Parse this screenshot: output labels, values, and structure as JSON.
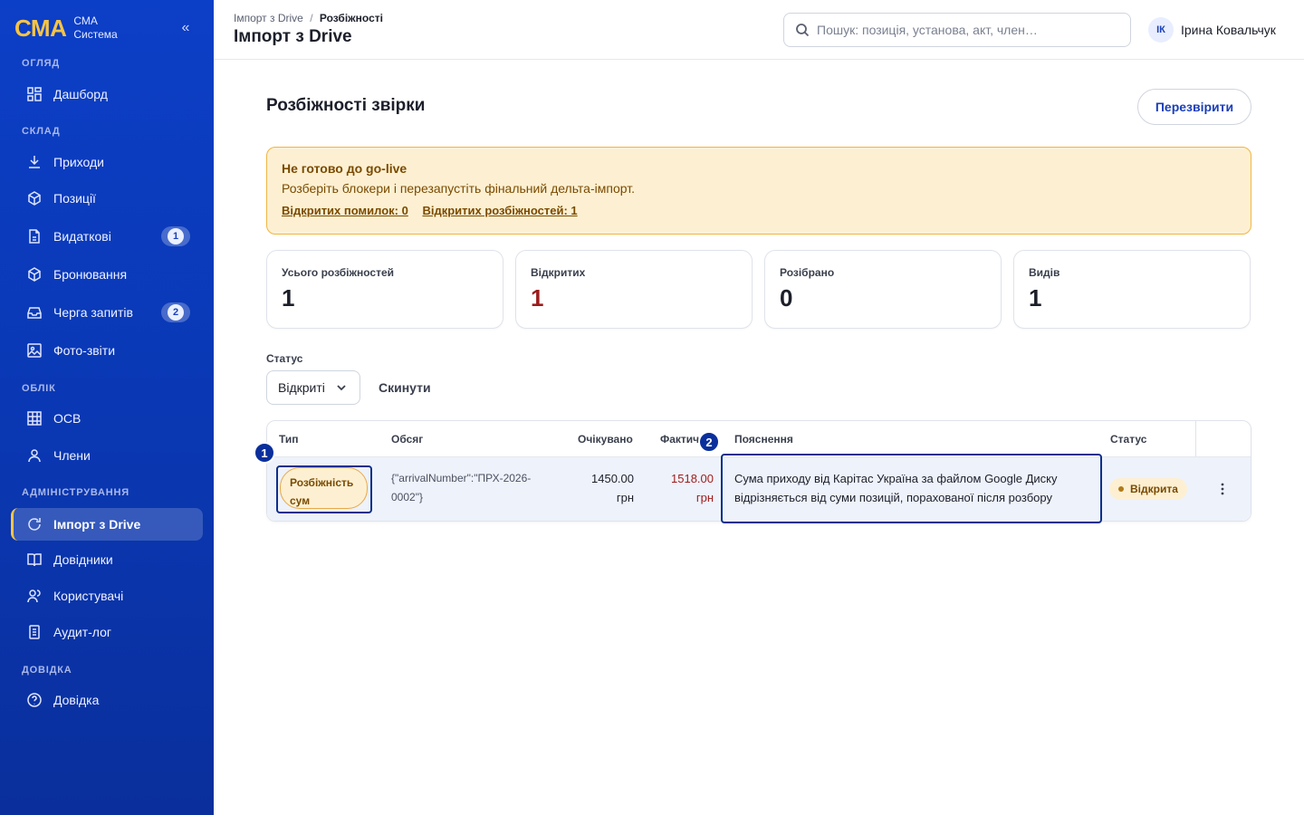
{
  "brand": {
    "logo": "СМА",
    "line1": "СМА",
    "line2": "Система",
    "collapse": "«"
  },
  "sidebar": {
    "sections": {
      "overview": "ОГЛЯД",
      "warehouse": "СКЛАД",
      "accounting": "ОБЛІК",
      "admin": "АДМІНІСТРУВАННЯ",
      "help": "ДОВІДКА"
    },
    "items": {
      "dashboard": {
        "label": "Дашборд",
        "icon": "grid-icon"
      },
      "arrivals": {
        "label": "Приходи",
        "icon": "download-icon"
      },
      "positions": {
        "label": "Позиції",
        "icon": "box-icon"
      },
      "expenses": {
        "label": "Видаткові",
        "icon": "document-icon",
        "badge": "1"
      },
      "bookings": {
        "label": "Бронювання",
        "icon": "box-icon"
      },
      "requests": {
        "label": "Черга запитів",
        "icon": "inbox-icon",
        "badge": "2"
      },
      "photos": {
        "label": "Фото-звіти",
        "icon": "image-icon"
      },
      "osv": {
        "label": "ОСВ",
        "icon": "table-icon"
      },
      "members": {
        "label": "Члени",
        "icon": "user-icon"
      },
      "drive_import": {
        "label": "Імпорт з Drive",
        "icon": "refresh-icon"
      },
      "directories": {
        "label": "Довідники",
        "icon": "book-icon"
      },
      "users": {
        "label": "Користувачі",
        "icon": "users-icon"
      },
      "audit": {
        "label": "Аудит-лог",
        "icon": "log-icon"
      },
      "help": {
        "label": "Довідка",
        "icon": "help-icon"
      }
    }
  },
  "header": {
    "breadcrumb_parent": "Імпорт з Drive",
    "breadcrumb_sep": "/",
    "breadcrumb_current": "Розбіжності",
    "title": "Імпорт з Drive",
    "search_placeholder": "Пошук: позиція, установа, акт, член…",
    "user_initials": "ІК",
    "user_name": "Ірина Ковальчук"
  },
  "main": {
    "title": "Розбіжності звірки",
    "recheck_label": "Перезвірити",
    "alert": {
      "title": "Не готово до go-live",
      "text": "Розберіть блокери і перезапустіть фінальний дельта-імпорт.",
      "link_errors": "Відкритих помилок: 0",
      "link_discrepancies": "Відкритих розбіжностей: 1"
    },
    "stats": [
      {
        "label": "Усього розбіжностей",
        "value": "1"
      },
      {
        "label": "Відкритих",
        "value": "1"
      },
      {
        "label": "Розібрано",
        "value": "0"
      },
      {
        "label": "Видів",
        "value": "1"
      }
    ],
    "filter": {
      "label": "Статус",
      "selected": "Відкриті",
      "reset": "Скинути"
    },
    "table": {
      "columns": [
        "Тип",
        "Обсяг",
        "Очікувано",
        "Фактич",
        "Пояснення",
        "Статус"
      ],
      "rows": [
        {
          "type": "Розбіжність сум",
          "scope": "{\"arrivalNumber\":\"ПРХ-2026-0002\"}",
          "expected": "1450.00 грн",
          "actual": "1518.00 грн",
          "explanation": "Сума приходу від Карітас Україна за файлом Google Диску відрізняється від суми позицій, порахованої після розбору",
          "status": "Відкрита"
        }
      ]
    },
    "markers": [
      "1",
      "2"
    ]
  },
  "colors": {
    "sidebar": "#0c3fc7",
    "accent": "#f6c445",
    "primary": "#1a3fb8",
    "warning_bg": "#fdf0d2",
    "danger": "#9c1c1c"
  }
}
